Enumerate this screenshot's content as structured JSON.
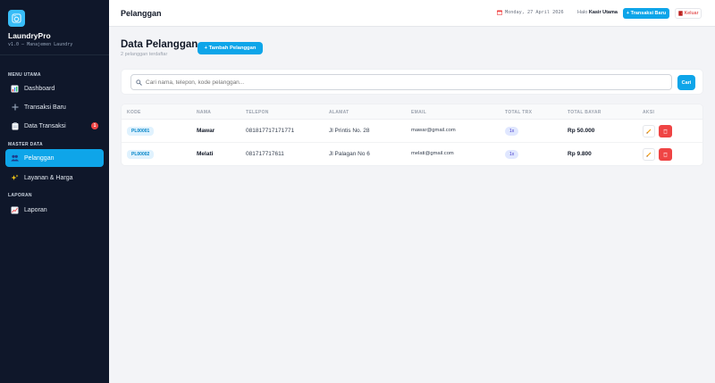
{
  "brand": {
    "name": "LaundryPro",
    "subtitle": "v1.0 — Manajemen Laundry",
    "logo_icon": "washing-machine-icon"
  },
  "sidebar": {
    "sections": [
      "MENU UTAMA",
      "MASTER DATA",
      "LAPORAN"
    ],
    "items": [
      {
        "label": "Dashboard",
        "icon": "chart-icon",
        "active": false
      },
      {
        "label": "Transaksi Baru",
        "icon": "plus-icon",
        "active": false
      },
      {
        "label": "Data Transaksi",
        "icon": "clipboard-icon",
        "active": false,
        "badge": "1"
      },
      {
        "label": "Pelanggan",
        "icon": "users-icon",
        "active": true
      },
      {
        "label": "Layanan & Harga",
        "icon": "sparkles-icon",
        "active": false
      },
      {
        "label": "Laporan",
        "icon": "line-chart-icon",
        "active": false
      }
    ]
  },
  "header": {
    "title": "Pelanggan",
    "date": "Monday, 27 April 2026",
    "greeting_prefix": "Halo",
    "user": "Kasir Utama",
    "new_transaction_label": "+ Transaksi Baru",
    "logout_label": "Keluar"
  },
  "main": {
    "heading": "Data Pelanggan",
    "subheading": "2 pelanggan terdaftar",
    "add_button_label": "+ Tambah Pelanggan",
    "search_placeholder": "Cari nama, telepon, kode pelanggan...",
    "search_button_label": "Cari",
    "columns": [
      "KODE",
      "NAMA",
      "TELEPON",
      "ALAMAT",
      "EMAIL",
      "TOTAL TRX",
      "TOTAL BAYAR",
      "AKSI"
    ],
    "rows": [
      {
        "code": "PL00001",
        "name": "Mawar",
        "phone": "081817717171771",
        "address": "Jl Printis No. 28",
        "email": "mawar@gmail.com",
        "trx": "1x",
        "total": "Rp 50.000"
      },
      {
        "code": "PL00002",
        "name": "Melati",
        "phone": "081717717611",
        "address": "Jl Palagan No 6",
        "email": "melati@gmail.com",
        "trx": "1x",
        "total": "Rp 9.800"
      }
    ]
  },
  "colors": {
    "accent": "#0ea5e9",
    "sidebar": "#0f172a",
    "danger": "#ef4444"
  }
}
